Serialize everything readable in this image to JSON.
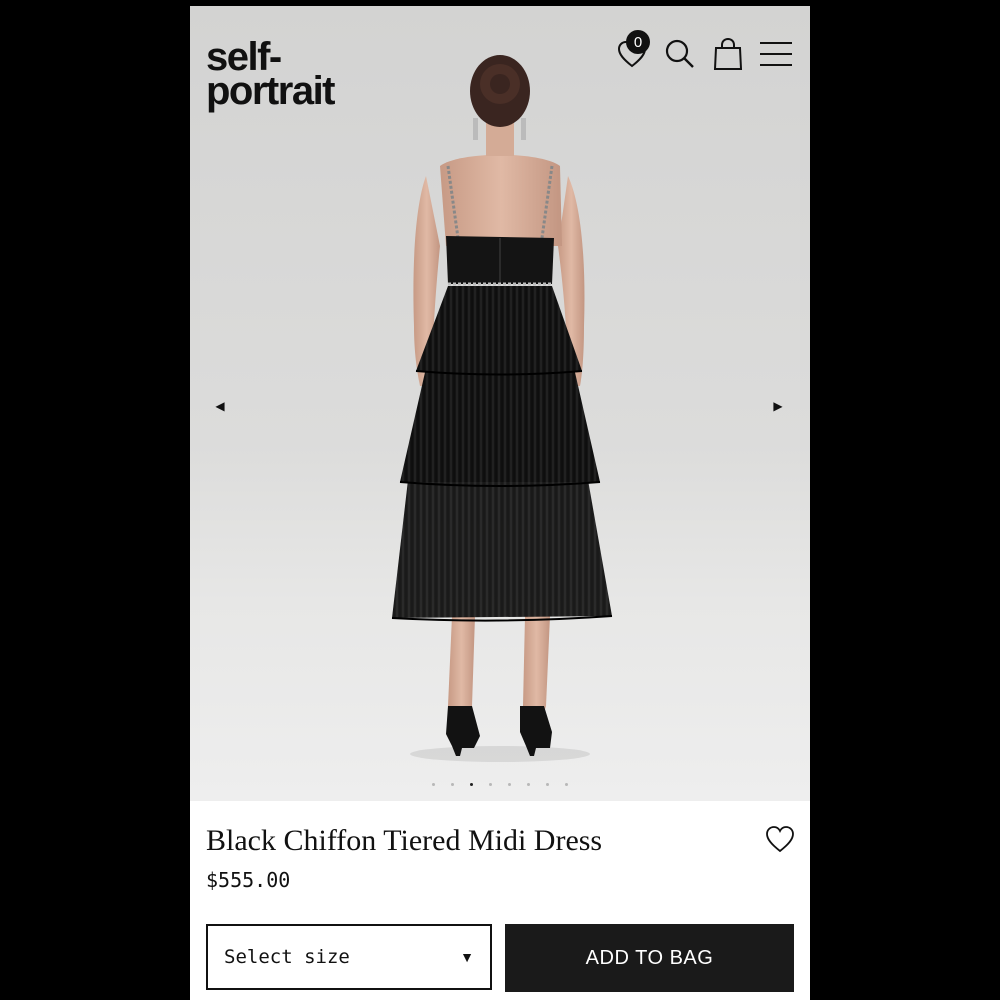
{
  "brand": {
    "logo_line1": "self-",
    "logo_line2": "portrait"
  },
  "header": {
    "wishlist_count": "0"
  },
  "gallery": {
    "slide_count": 8,
    "active_index": 2
  },
  "product": {
    "name": "Black Chiffon Tiered Midi Dress",
    "price": "$555.00"
  },
  "size_selector": {
    "label": "Select size"
  },
  "add_to_bag": {
    "label": "ADD TO BAG"
  },
  "icons": {
    "wishlist": "heart-icon",
    "search": "search-icon",
    "bag": "shopping-bag-icon",
    "menu": "hamburger-menu-icon",
    "prev": "triangle-left-icon",
    "next": "triangle-right-icon",
    "dropdown": "triangle-down-icon"
  },
  "colors": {
    "accent": "#1a1a1a",
    "background": "#ffffff"
  }
}
